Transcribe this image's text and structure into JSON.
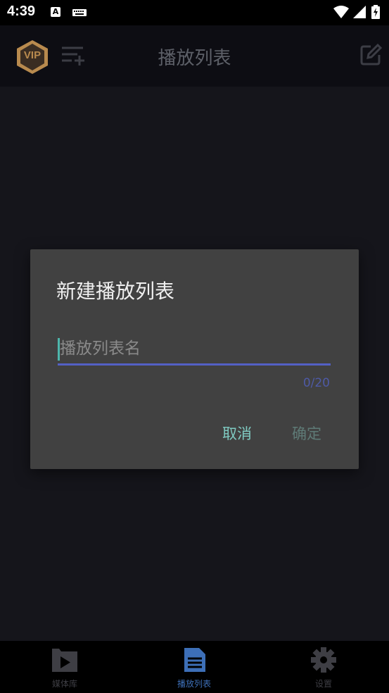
{
  "status_bar": {
    "time": "4:39",
    "notification_letter": "A"
  },
  "app_bar": {
    "title": "播放列表",
    "vip_label": "VIP"
  },
  "dialog": {
    "title": "新建播放列表",
    "input_placeholder": "播放列表名",
    "input_value": "",
    "counter": "0/20",
    "cancel_label": "取消",
    "confirm_label": "确定"
  },
  "bottom_nav": {
    "items": [
      {
        "label": "媒体库",
        "icon": "video-library-icon",
        "active": false
      },
      {
        "label": "播放列表",
        "icon": "document-list-icon",
        "active": true
      },
      {
        "label": "设置",
        "icon": "gear-icon",
        "active": false
      }
    ]
  },
  "colors": {
    "accent_teal": "#7fcbc2",
    "input_underline": "#5360c5",
    "nav_active": "#3d6fb7"
  }
}
